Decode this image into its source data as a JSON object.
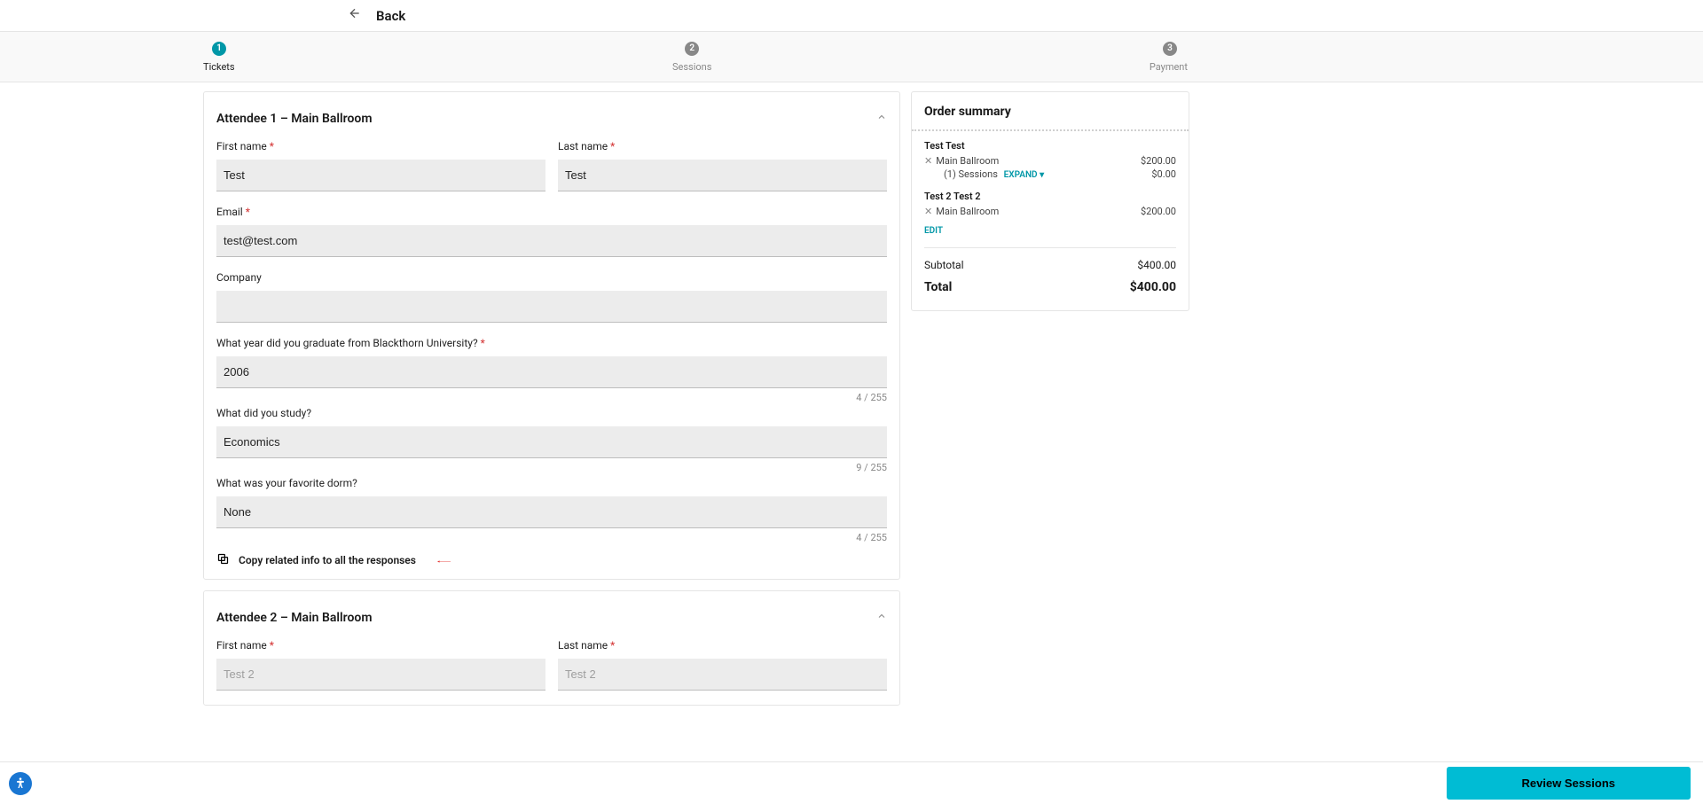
{
  "header": {
    "back_label": "Back"
  },
  "steps": [
    {
      "num": "1",
      "label": "Tickets",
      "active": true
    },
    {
      "num": "2",
      "label": "Sessions",
      "active": false
    },
    {
      "num": "3",
      "label": "Payment",
      "active": false
    }
  ],
  "attendee1": {
    "title": "Attendee 1  –  Main Ballroom",
    "first_name": {
      "label": "First name",
      "value": "Test",
      "required": true
    },
    "last_name": {
      "label": "Last name",
      "value": "Test",
      "required": true
    },
    "email": {
      "label": "Email",
      "value": "test@test.com",
      "required": true
    },
    "company": {
      "label": "Company",
      "value": ""
    },
    "grad_year": {
      "label": "What year did you graduate from Blackthorn University?",
      "value": "2006",
      "required": true,
      "counter": "4 / 255"
    },
    "study": {
      "label": "What did you study?",
      "value": "Economics",
      "counter": "9 / 255"
    },
    "dorm": {
      "label": "What was your favorite dorm?",
      "value": "None",
      "counter": "4 / 255"
    },
    "copy_label": "Copy related info to all the responses"
  },
  "attendee2": {
    "title": "Attendee 2  –  Main Ballroom",
    "first_name": {
      "label": "First name",
      "value": "Test 2",
      "required": true
    },
    "last_name": {
      "label": "Last name",
      "value": "Test 2",
      "required": true
    }
  },
  "summary": {
    "title": "Order summary",
    "items": [
      {
        "name": "Test Test",
        "ticket": "Main Ballroom",
        "price": "$200.00",
        "sessions": {
          "label": "(1) Sessions",
          "expand": "EXPAND",
          "price": "$0.00"
        }
      },
      {
        "name": "Test 2 Test 2",
        "ticket": "Main Ballroom",
        "price": "$200.00"
      }
    ],
    "edit": "EDIT",
    "subtotal": {
      "label": "Subtotal",
      "value": "$400.00"
    },
    "total": {
      "label": "Total",
      "value": "$400.00"
    }
  },
  "footer": {
    "review_label": "Review Sessions"
  }
}
